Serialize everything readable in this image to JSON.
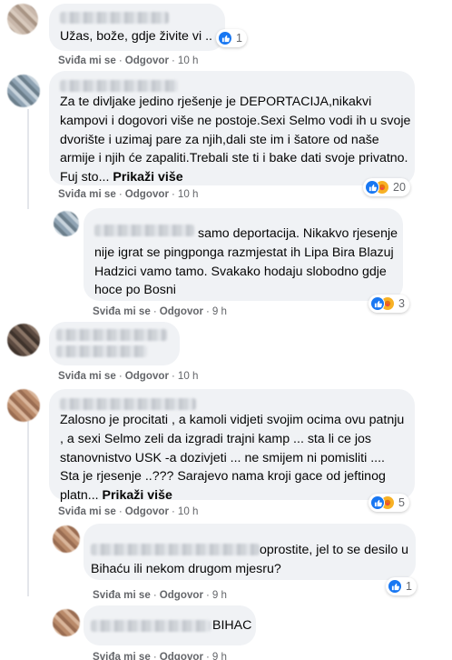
{
  "actions": {
    "like": "Sviđa mi se",
    "reply": "Odgovor",
    "separator": "·",
    "more": "Prikaži više"
  },
  "comments": [
    {
      "text": "Užas, bože, gdje živite vi ..",
      "time": "10 h",
      "reactions": {
        "count": "1",
        "types": [
          "like"
        ]
      }
    },
    {
      "text": "Za te divljake jedino rješenje je DEPORTACIJA,nikakvi kampovi i dogovori više ne postoje.Sexi Selmo vodi ih u svoje dvorište i uzimaj pare za njih,dali ste im i šatore od naše armije i njih će zapaliti.Trebali ste ti i bake dati svoje privatno. Fuj sto...",
      "time": "10 h",
      "reactions": {
        "count": "20",
        "types": [
          "like",
          "care"
        ]
      }
    },
    {
      "text": "samo deportacija. Nikakvo rjesenje nije igrat se pingponga razmjestat ih Lipa Bira Blazuj Hadzici vamo tamo. Svakako hodaju slobodno gdje hoce po Bosni",
      "time": "9 h",
      "reactions": {
        "count": "3",
        "types": [
          "like",
          "care"
        ]
      }
    },
    {
      "text": "",
      "time": "10 h"
    },
    {
      "text": "Zalosno je procitati , a kamoli vidjeti svojim ocima ovu patnju , a sexi Selmo zeli da izgradi trajni kamp ... sta li ce jos stanovnistvo USK -a dozivjeti ... ne smijem ni pomisliti .... Sta je rjesenje ..??? Sarajevo nama kroji gace od jeftinog platn...",
      "time": "10 h",
      "reactions": {
        "count": "5",
        "types": [
          "like",
          "care"
        ]
      }
    },
    {
      "text": "oprostite, jel to se desilo u Bihaću ili nekom drugom mjesru?",
      "time": "9 h",
      "reactions": {
        "count": "1",
        "types": [
          "like"
        ]
      }
    },
    {
      "text": "BIHAC",
      "time": "9 h"
    }
  ]
}
